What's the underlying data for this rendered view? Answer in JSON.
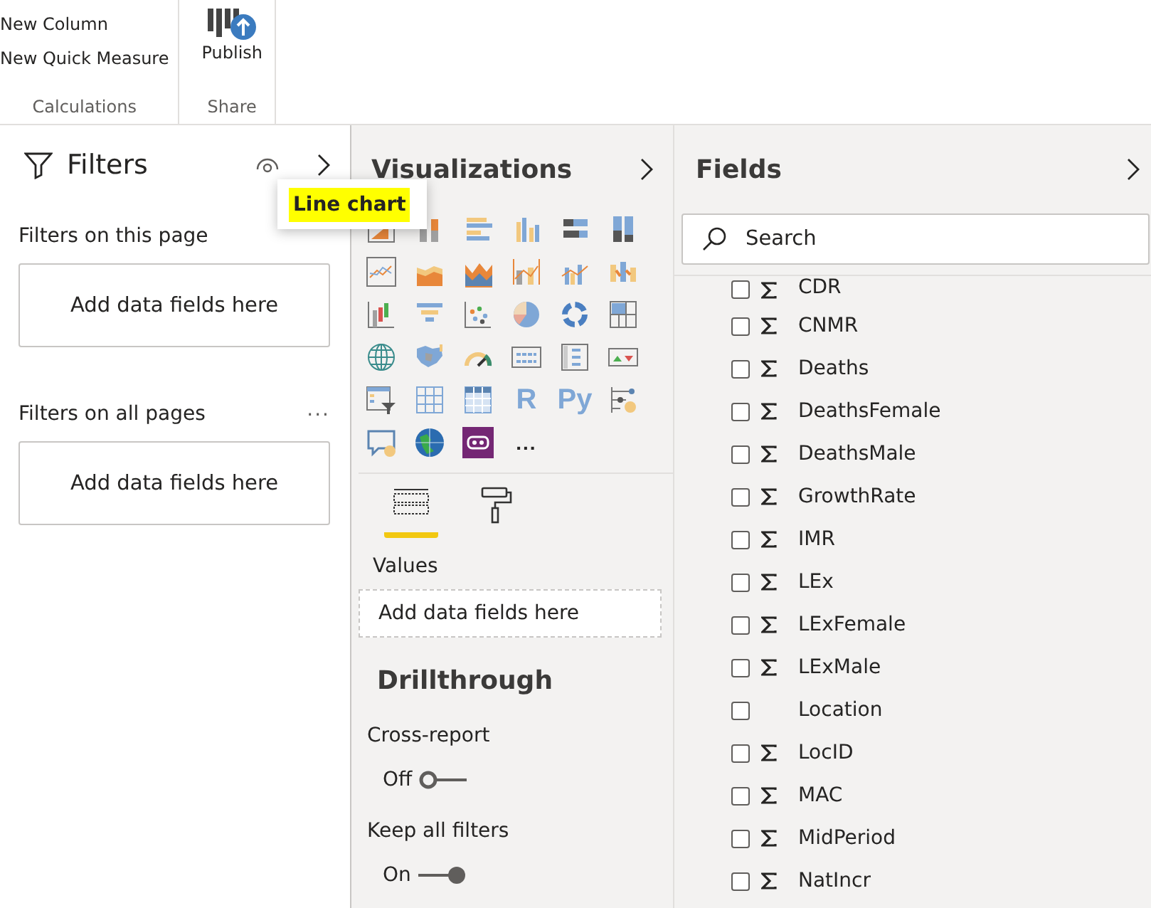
{
  "ribbon": {
    "groups": [
      {
        "label": "Calculations",
        "items": [
          {
            "kind": "text",
            "label": "New Column"
          },
          {
            "kind": "text",
            "label": "New Quick Measure"
          }
        ]
      },
      {
        "label": "Share",
        "items": [
          {
            "kind": "publish",
            "label": "Publish"
          }
        ]
      }
    ]
  },
  "filters": {
    "title": "Filters",
    "sections": [
      {
        "label": "Filters on this page",
        "placeholder": "Add data fields here"
      },
      {
        "label": "Filters on all pages",
        "more": "...",
        "placeholder": "Add data fields here"
      }
    ]
  },
  "visualizations": {
    "title": "Visualizations",
    "tooltip": "Line chart",
    "icons": [
      {
        "kind": "stacked-bar"
      },
      {
        "kind": "stacked-column"
      },
      {
        "kind": "clustered-bar"
      },
      {
        "kind": "clustered-column"
      },
      {
        "kind": "full-bar"
      },
      {
        "kind": "full-column"
      },
      {
        "kind": "line"
      },
      {
        "kind": "area"
      },
      {
        "kind": "stacked-area"
      },
      {
        "kind": "line-column"
      },
      {
        "kind": "line-clustered"
      },
      {
        "kind": "ribbon"
      },
      {
        "kind": "waterfall"
      },
      {
        "kind": "funnel"
      },
      {
        "kind": "scatter"
      },
      {
        "kind": "pie"
      },
      {
        "kind": "donut"
      },
      {
        "kind": "treemap"
      },
      {
        "kind": "map"
      },
      {
        "kind": "filled-map"
      },
      {
        "kind": "gauge"
      },
      {
        "kind": "card"
      },
      {
        "kind": "multirow-card"
      },
      {
        "kind": "kpi"
      },
      {
        "kind": "slicer"
      },
      {
        "kind": "table"
      },
      {
        "kind": "matrix"
      },
      {
        "kind": "label",
        "label": "R"
      },
      {
        "kind": "label",
        "label": "Py"
      },
      {
        "kind": "influencers"
      },
      {
        "kind": "qa"
      },
      {
        "kind": "globe"
      },
      {
        "kind": "custom"
      },
      {
        "kind": "more",
        "label": "..."
      }
    ],
    "tabs": [
      {
        "kind": "fields",
        "selected": true
      },
      {
        "kind": "format",
        "selected": false
      }
    ],
    "values_label": "Values",
    "values_placeholder": "Add data fields here",
    "drillthrough": {
      "title": "Drillthrough",
      "toggles": [
        {
          "label": "Cross-report",
          "state": "Off",
          "on": false
        },
        {
          "label": "Keep all filters",
          "state": "On",
          "on": true
        }
      ]
    }
  },
  "fields": {
    "title": "Fields",
    "search": {
      "placeholder": "Search"
    },
    "items": [
      {
        "name": "CDR",
        "kind": "measure",
        "checked": false
      },
      {
        "name": "CNMR",
        "kind": "measure",
        "checked": false
      },
      {
        "name": "Deaths",
        "kind": "measure",
        "checked": false
      },
      {
        "name": "DeathsFemale",
        "kind": "measure",
        "checked": false
      },
      {
        "name": "DeathsMale",
        "kind": "measure",
        "checked": false
      },
      {
        "name": "GrowthRate",
        "kind": "measure",
        "checked": false
      },
      {
        "name": "IMR",
        "kind": "measure",
        "checked": false
      },
      {
        "name": "LEx",
        "kind": "measure",
        "checked": false
      },
      {
        "name": "LExFemale",
        "kind": "measure",
        "checked": false
      },
      {
        "name": "LExMale",
        "kind": "measure",
        "checked": false
      },
      {
        "name": "Location",
        "kind": "text",
        "checked": false
      },
      {
        "name": "LocID",
        "kind": "measure",
        "checked": false
      },
      {
        "name": "MAC",
        "kind": "measure",
        "checked": false
      },
      {
        "name": "MidPeriod",
        "kind": "measure",
        "checked": false
      },
      {
        "name": "NatIncr",
        "kind": "measure",
        "checked": false
      }
    ]
  }
}
